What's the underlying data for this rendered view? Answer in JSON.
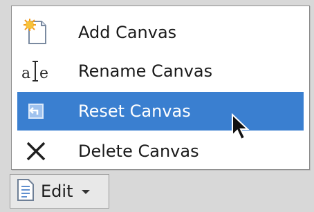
{
  "menu": {
    "items": [
      {
        "label": "Add Canvas",
        "icon": "add-canvas-icon",
        "selected": false
      },
      {
        "label": "Rename Canvas",
        "icon": "rename-icon",
        "selected": false
      },
      {
        "label": "Reset Canvas",
        "icon": "reset-icon",
        "selected": true
      },
      {
        "label": "Delete Canvas",
        "icon": "delete-icon",
        "selected": false
      }
    ],
    "highlight_color": "#3a7fd0"
  },
  "toolbar": {
    "edit_label": "Edit",
    "edit_icon": "document-icon",
    "dropdown_icon": "chevron-down-icon"
  }
}
